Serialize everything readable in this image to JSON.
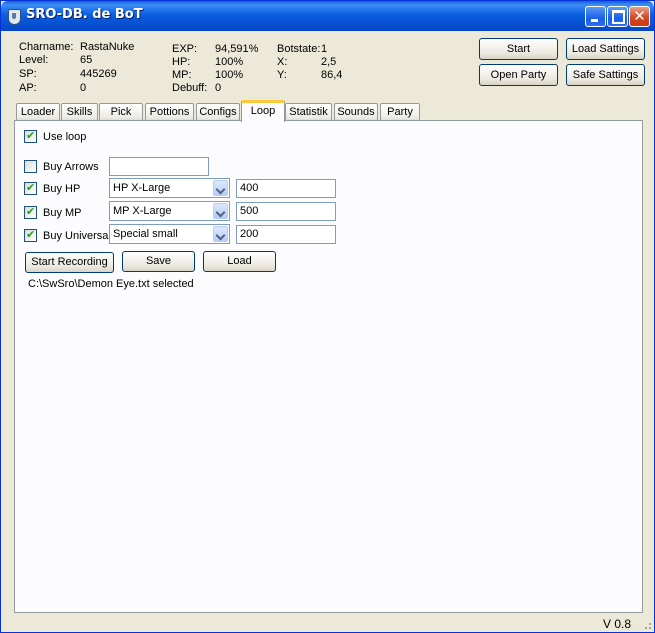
{
  "window": {
    "title": "SRO-DB. de BoT"
  },
  "stats": {
    "charname_label": "Charname:",
    "charname_value": "RastaNuke",
    "level_label": "Level:",
    "level_value": "65",
    "sp_label": "SP:",
    "sp_value": "445269",
    "ap_label": "AP:",
    "ap_value": "0",
    "exp_label": "EXP:",
    "exp_value": "94,591%",
    "hp_label": "HP:",
    "hp_value": "100%",
    "mp_label": "MP:",
    "mp_value": "100%",
    "debuff_label": "Debuff:",
    "debuff_value": "0",
    "botstate_label": "Botstate:",
    "botstate_value": "1",
    "x_label": "X:",
    "x_value": "2,5",
    "y_label": "Y:",
    "y_value": "86,4"
  },
  "buttons": {
    "start": "Start",
    "load_settings": "Load Sattings",
    "open_party": "Open Party",
    "safe_settings": "Safe Sattings"
  },
  "tabs": [
    {
      "label": "Loader"
    },
    {
      "label": "Skills"
    },
    {
      "label": "Pick"
    },
    {
      "label": "Pottions"
    },
    {
      "label": "Configs"
    },
    {
      "label": "Loop"
    },
    {
      "label": "Statistik"
    },
    {
      "label": "Sounds"
    },
    {
      "label": "Party"
    }
  ],
  "active_tab": "Loop",
  "loop": {
    "use_loop_label": "Use loop",
    "use_loop_checked": true,
    "buy_arrows_label": "Buy Arrows",
    "buy_arrows_checked": false,
    "buy_arrows_value": "",
    "buy_hp_label": "Buy HP",
    "buy_hp_checked": true,
    "buy_hp_item": "HP X-Large",
    "buy_hp_qty": "400",
    "buy_mp_label": "Buy MP",
    "buy_mp_checked": true,
    "buy_mp_item": "MP X-Large",
    "buy_mp_qty": "500",
    "buy_universal_label": "Buy Universal",
    "buy_universal_checked": true,
    "buy_universal_item": "Special small",
    "buy_universal_qty": "200",
    "start_recording": "Start Recording",
    "save": "Save",
    "load": "Load",
    "status": "C:\\SwSro\\Demon Eye.txt selected"
  },
  "version": "V 0.8",
  "icons": {
    "tick": "✔",
    "close": "✕"
  },
  "colors": {
    "titlebar": "#0a5fd8",
    "window_bg": "#ece9d8",
    "tab_highlight": "#ffc83c",
    "check_green": "#21a121"
  }
}
